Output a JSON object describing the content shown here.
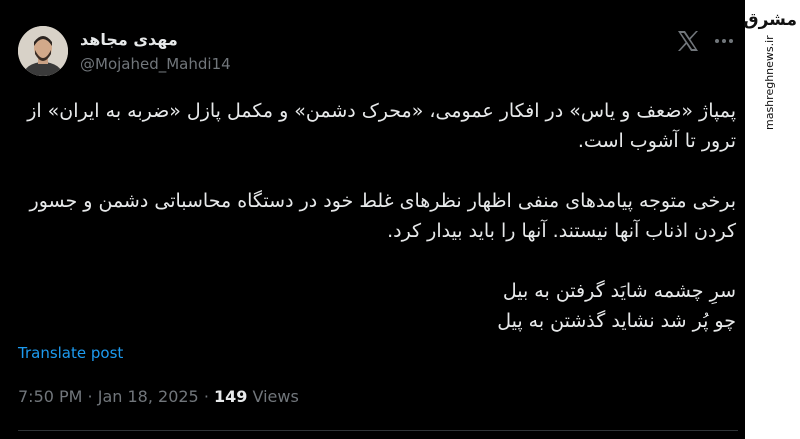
{
  "author": {
    "name": "مهدی مجاهد",
    "handle": "@Mojahed_Mahdi14"
  },
  "icons": {
    "platform": "x-logo-icon",
    "more": "more-options-icon"
  },
  "post": {
    "paragraph1": "پمپاژ «ضعف و یاس» در افکار عمومی، «محرک دشمن» و مکمل پازل «ضربه به ایران» از ترور تا آشوب است.",
    "paragraph2": "برخی متوجه پیامدهای منفی اظهار نظرهای غلط خود در دستگاه محاسباتی دشمن و جسور کردن اذناب آنها نیستند. آنها را باید بیدار کرد.",
    "verse_line1": "سرِ چشمه شایَد گرفتن به بیل",
    "verse_line2": "چو پُر شد نشاید گذشتن به پیل"
  },
  "translate_label": "Translate post",
  "meta": {
    "time": "7:50 PM",
    "separator": " · ",
    "date": "Jan 18, 2025",
    "views_count": "149",
    "views_label": "Views"
  },
  "watermark": {
    "logo_text": "مشرق",
    "site": "mashreghnews.ir"
  },
  "colors": {
    "background": "#000000",
    "text": "#e7e9ea",
    "muted": "#71767b",
    "link": "#1d9bf0"
  }
}
